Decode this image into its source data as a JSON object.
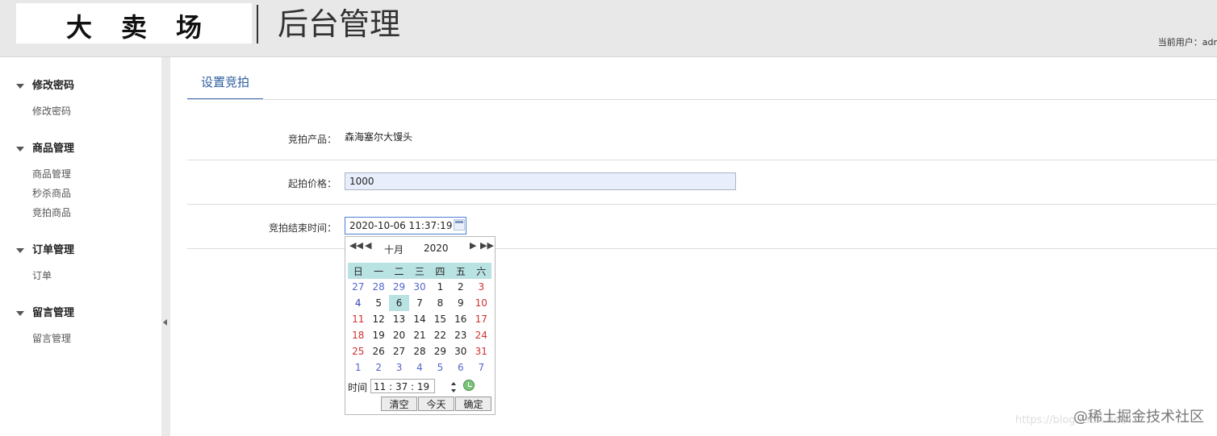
{
  "header": {
    "logo_text": "大卖场",
    "title": "后台管理",
    "current_user": "当前用户：adr"
  },
  "sidebar": {
    "groups": [
      {
        "title": "修改密码",
        "items": [
          "修改密码"
        ]
      },
      {
        "title": "商品管理",
        "items": [
          "商品管理",
          "秒杀商品",
          "竞拍商品"
        ]
      },
      {
        "title": "订单管理",
        "items": [
          "订单"
        ]
      },
      {
        "title": "留言管理",
        "items": [
          "留言管理"
        ]
      }
    ]
  },
  "main": {
    "tab": "设置竞拍",
    "form": {
      "product_label": "竞拍产品：",
      "product_value": "森海塞尔大馒头",
      "price_label": "起拍价格：",
      "price_value": "1000",
      "end_time_label": "竞拍结束时间：",
      "end_time_value": "2020-10-06 11:37:19"
    }
  },
  "calendar": {
    "month": "十月",
    "year": "2020",
    "weekdays": [
      "日",
      "一",
      "二",
      "三",
      "四",
      "五",
      "六"
    ],
    "weeks": [
      [
        "27",
        "28",
        "29",
        "30",
        "1",
        "2",
        "3"
      ],
      [
        "4",
        "5",
        "6",
        "7",
        "8",
        "9",
        "10"
      ],
      [
        "11",
        "12",
        "13",
        "14",
        "15",
        "16",
        "17"
      ],
      [
        "18",
        "19",
        "20",
        "21",
        "22",
        "23",
        "24"
      ],
      [
        "25",
        "26",
        "27",
        "28",
        "29",
        "30",
        "31"
      ],
      [
        "1",
        "2",
        "3",
        "4",
        "5",
        "6",
        "7"
      ]
    ],
    "selected_day": "6",
    "time_label": "时间",
    "time_value": "11 : 37 : 19",
    "buttons": {
      "clear": "清空",
      "today": "今天",
      "confirm": "确定"
    }
  },
  "watermark": "@稀土掘金技术社区",
  "watermark_url": "https://blog.csdn.net/"
}
